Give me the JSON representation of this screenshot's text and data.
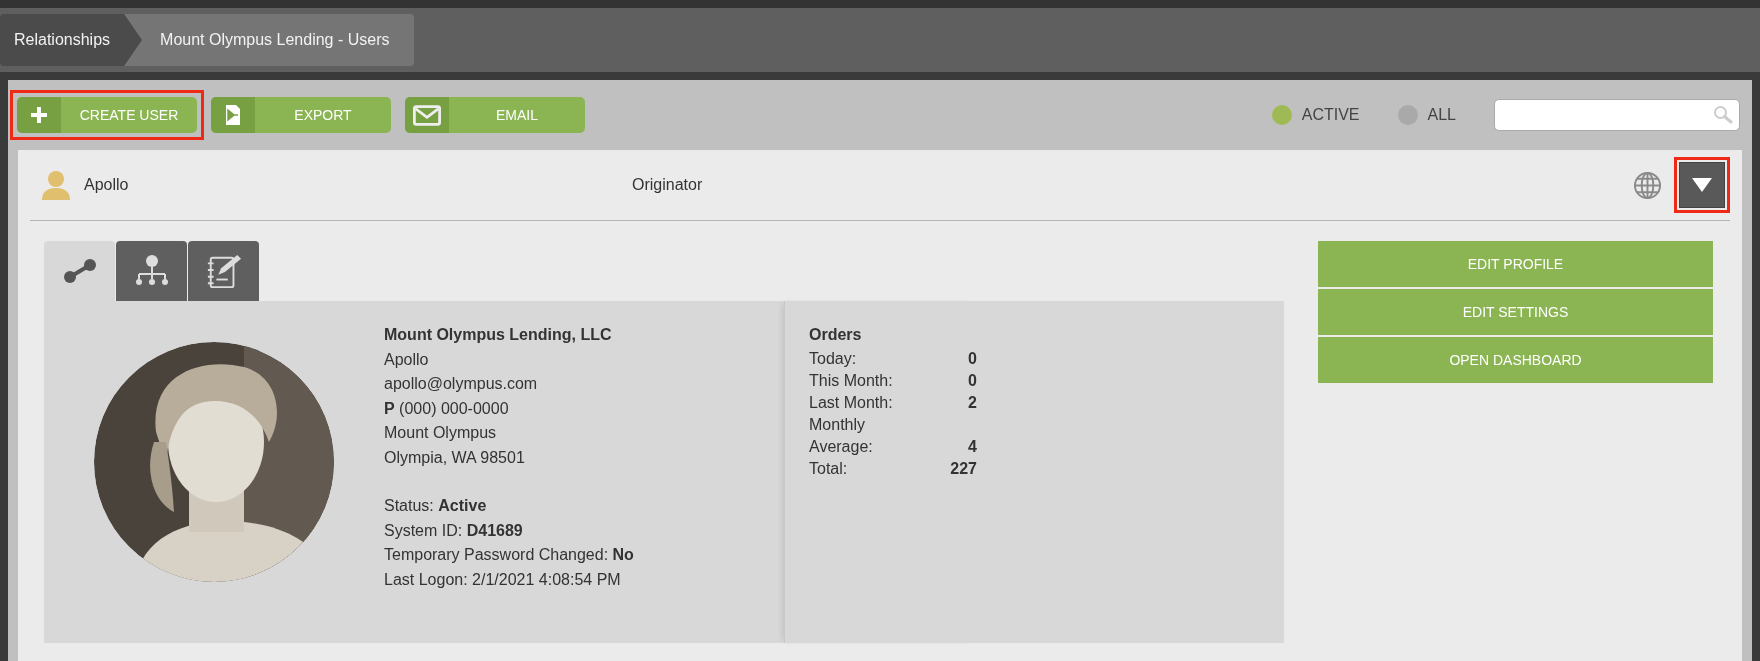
{
  "breadcrumbs": [
    {
      "label": "Relationships",
      "current": false
    },
    {
      "label": "Mount Olympus Lending - Users",
      "current": true
    }
  ],
  "toolbar": {
    "buttons": [
      {
        "label": "CREATE USER",
        "kind": "create",
        "highlighted": true
      },
      {
        "label": "EXPORT",
        "kind": "export",
        "highlighted": false
      },
      {
        "label": "EMAIL",
        "kind": "email",
        "highlighted": false
      }
    ],
    "filters": [
      {
        "label": "ACTIVE",
        "selected": true
      },
      {
        "label": "ALL",
        "selected": false
      }
    ]
  },
  "user": {
    "name": "Apollo",
    "role": "Originator",
    "menu_highlighted": true,
    "tabs": [
      {
        "kind": "connections",
        "selected": true
      },
      {
        "kind": "hierarchy",
        "selected": false
      },
      {
        "kind": "notes",
        "selected": false
      }
    ],
    "profile": {
      "company": "Mount Olympus Lending, LLC",
      "contact_lines": [
        "Apollo",
        "apollo@olympus.com",
        "**P** (000) 000-0000",
        "Mount Olympus",
        "Olympia, WA 98501"
      ],
      "status_lines": [
        "Status: **Active**",
        "System ID: **D41689**",
        "Temporary Password Changed: **No**",
        "Last Logon: 2/1/2021 4:08:54 PM"
      ]
    },
    "orders": {
      "title": "Orders",
      "rows": [
        {
          "label": "Today:",
          "value": "0"
        },
        {
          "label": "This Month:",
          "value": "0"
        },
        {
          "label": "Last Month:",
          "value": "2"
        },
        {
          "label": "Monthly Average:",
          "value": "4"
        },
        {
          "label": "Total:",
          "value": "227"
        }
      ]
    },
    "actions": [
      "EDIT PROFILE",
      "EDIT SETTINGS",
      "OPEN DASHBOARD"
    ]
  }
}
